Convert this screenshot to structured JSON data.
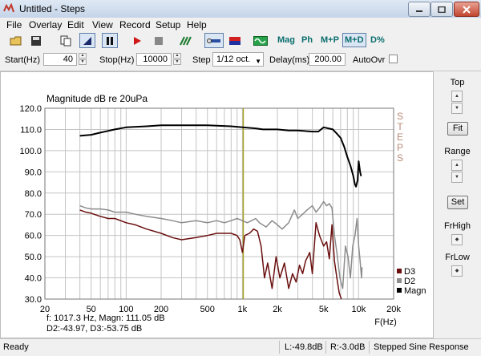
{
  "window": {
    "title": "Untitled - Steps",
    "app_icon": "steps-app-icon"
  },
  "menu": [
    "File",
    "Overlay",
    "Edit",
    "View",
    "Record",
    "Setup",
    "Help"
  ],
  "toolbar": {
    "icons": [
      "open-folder-icon",
      "save-disk-icon",
      "copy-icon",
      "sweep-forward-icon",
      "pause-icon",
      "record-icon",
      "stop-icon",
      "grid-icon",
      "link-icon",
      "flag-icon",
      "waveform-icon"
    ],
    "mag_label": "Mag",
    "ph_label": "Ph",
    "mp_label": "M+P",
    "md_label": "M+D",
    "dpct_label": "D%"
  },
  "params": {
    "start_label": "Start(Hz)",
    "start_value": "40",
    "stop_label": "Stop(Hz)",
    "stop_value": "10000",
    "step_label": "Step",
    "step_value": "1/12 oct.",
    "delay_label": "Delay(ms)",
    "delay_value": "200.00",
    "autoovr_label": "AutoOvr"
  },
  "side": {
    "top_label": "Top",
    "fit_label": "Fit",
    "range_label": "Range",
    "set_label": "Set",
    "frhigh_label": "FrHigh",
    "frlow_label": "FrLow"
  },
  "status": {
    "ready": "Ready",
    "left": "L:-49.8dB",
    "right": "R:-3.0dB",
    "mode": "Stepped Sine Response"
  },
  "chart_data": {
    "type": "line",
    "title": "Magnitude dB re 20uPa",
    "xlabel": "F(Hz)",
    "x_scale": "log",
    "xlim": [
      20,
      20000
    ],
    "ylim": [
      30,
      120
    ],
    "x_ticks": [
      {
        "v": 20,
        "label": "20"
      },
      {
        "v": 50,
        "label": "50"
      },
      {
        "v": 100,
        "label": "100"
      },
      {
        "v": 200,
        "label": "200"
      },
      {
        "v": 500,
        "label": "500"
      },
      {
        "v": 1000,
        "label": "1k"
      },
      {
        "v": 2000,
        "label": "2k"
      },
      {
        "v": 5000,
        "label": "5k"
      },
      {
        "v": 10000,
        "label": "10k"
      },
      {
        "v": 20000,
        "label": "20k"
      }
    ],
    "y_ticks": [
      {
        "v": 120,
        "label": "120.0"
      },
      {
        "v": 110,
        "label": "110.0"
      },
      {
        "v": 100,
        "label": "100.0"
      },
      {
        "v": 90,
        "label": "90.0"
      },
      {
        "v": 80,
        "label": "80.0"
      },
      {
        "v": 70,
        "label": "70.0"
      },
      {
        "v": 60,
        "label": "60.0"
      },
      {
        "v": 50,
        "label": "50.0"
      },
      {
        "v": 40,
        "label": "40.0"
      },
      {
        "v": 30,
        "label": "30.0"
      }
    ],
    "grid": true,
    "watermark": "STEPS",
    "cursor": {
      "x": 1017.3,
      "readout_line1": "f: 1017.3 Hz, Magn: 111.05 dB",
      "readout_line2": "D2:-43.97, D3:-53.75 dB",
      "color": "#a8a020"
    },
    "legend_position": "bottom-right",
    "series": [
      {
        "name": "Magn",
        "color": "#000000",
        "points": [
          [
            40,
            107
          ],
          [
            50,
            107.5
          ],
          [
            60,
            108.5
          ],
          [
            80,
            110
          ],
          [
            100,
            111
          ],
          [
            150,
            111.5
          ],
          [
            200,
            112
          ],
          [
            300,
            112
          ],
          [
            500,
            112
          ],
          [
            800,
            111.5
          ],
          [
            1000,
            111
          ],
          [
            1300,
            110.5
          ],
          [
            1500,
            110
          ],
          [
            2000,
            110
          ],
          [
            2500,
            109.5
          ],
          [
            3000,
            109.5
          ],
          [
            4000,
            109
          ],
          [
            4500,
            109
          ],
          [
            5000,
            111
          ],
          [
            5500,
            110.5
          ],
          [
            6000,
            110
          ],
          [
            6500,
            108
          ],
          [
            7000,
            106
          ],
          [
            7500,
            102
          ],
          [
            8000,
            97
          ],
          [
            8500,
            93
          ],
          [
            9000,
            88
          ],
          [
            9300,
            84
          ],
          [
            9500,
            83
          ],
          [
            9800,
            86
          ],
          [
            10000,
            95
          ],
          [
            10300,
            90
          ],
          [
            10500,
            88
          ]
        ]
      },
      {
        "name": "D2",
        "color": "#8c8c8c",
        "points": [
          [
            40,
            74
          ],
          [
            45,
            73
          ],
          [
            50,
            72.5
          ],
          [
            60,
            72.5
          ],
          [
            70,
            72
          ],
          [
            80,
            71
          ],
          [
            100,
            71
          ],
          [
            120,
            70
          ],
          [
            150,
            69
          ],
          [
            200,
            68
          ],
          [
            250,
            67
          ],
          [
            300,
            66
          ],
          [
            400,
            67
          ],
          [
            500,
            66
          ],
          [
            600,
            67
          ],
          [
            700,
            66
          ],
          [
            800,
            67
          ],
          [
            900,
            68
          ],
          [
            1000,
            67
          ],
          [
            1100,
            66
          ],
          [
            1200,
            67
          ],
          [
            1300,
            68
          ],
          [
            1400,
            66
          ],
          [
            1600,
            64
          ],
          [
            1800,
            67
          ],
          [
            2000,
            65
          ],
          [
            2200,
            63
          ],
          [
            2500,
            66
          ],
          [
            2800,
            72
          ],
          [
            3000,
            68
          ],
          [
            3300,
            70
          ],
          [
            3600,
            72
          ],
          [
            4000,
            74
          ],
          [
            4300,
            71
          ],
          [
            4600,
            73
          ],
          [
            5000,
            76
          ],
          [
            5300,
            74
          ],
          [
            5600,
            75
          ],
          [
            5900,
            73
          ],
          [
            6200,
            60
          ],
          [
            6500,
            52
          ],
          [
            6900,
            40
          ],
          [
            7300,
            35
          ],
          [
            7700,
            55
          ],
          [
            8100,
            50
          ],
          [
            8500,
            40
          ],
          [
            8900,
            55
          ],
          [
            9300,
            60
          ],
          [
            9700,
            68
          ],
          [
            10000,
            55
          ],
          [
            10300,
            48
          ],
          [
            10600,
            40
          ],
          [
            10700,
            45
          ]
        ]
      },
      {
        "name": "D3",
        "color": "#6b0f0f",
        "points": [
          [
            40,
            72
          ],
          [
            45,
            71
          ],
          [
            50,
            70.5
          ],
          [
            60,
            69
          ],
          [
            70,
            68
          ],
          [
            80,
            68
          ],
          [
            100,
            66
          ],
          [
            120,
            65
          ],
          [
            150,
            63
          ],
          [
            200,
            61
          ],
          [
            250,
            59
          ],
          [
            300,
            58
          ],
          [
            400,
            59
          ],
          [
            500,
            60
          ],
          [
            600,
            61
          ],
          [
            700,
            61
          ],
          [
            800,
            61
          ],
          [
            900,
            60
          ],
          [
            950,
            58
          ],
          [
            1000,
            52
          ],
          [
            1050,
            60
          ],
          [
            1150,
            61
          ],
          [
            1250,
            63
          ],
          [
            1350,
            62
          ],
          [
            1450,
            55
          ],
          [
            1550,
            40
          ],
          [
            1650,
            47
          ],
          [
            1800,
            35
          ],
          [
            1950,
            50
          ],
          [
            2100,
            40
          ],
          [
            2300,
            47
          ],
          [
            2500,
            35
          ],
          [
            2700,
            42
          ],
          [
            2900,
            38
          ],
          [
            3100,
            46
          ],
          [
            3300,
            42
          ],
          [
            3500,
            48
          ],
          [
            3800,
            52
          ],
          [
            4000,
            42
          ],
          [
            4300,
            66
          ],
          [
            4600,
            60
          ],
          [
            5000,
            55
          ],
          [
            5300,
            57
          ],
          [
            5600,
            49
          ],
          [
            5900,
            65
          ],
          [
            6200,
            48
          ],
          [
            6500,
            40
          ],
          [
            6800,
            33
          ],
          [
            7100,
            30
          ]
        ]
      }
    ]
  }
}
